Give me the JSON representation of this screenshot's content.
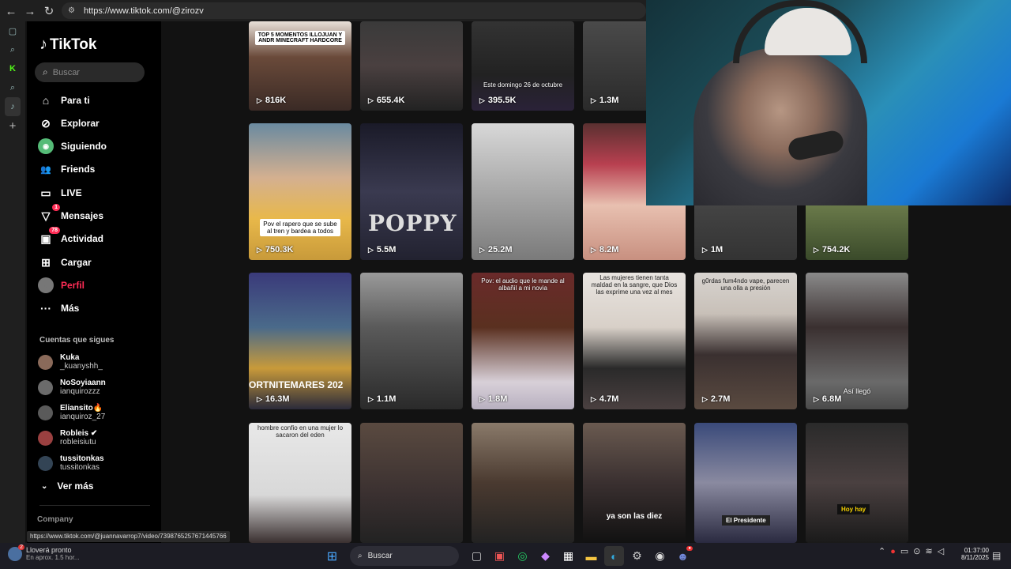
{
  "browser": {
    "url": "https://www.tiktok.com/@zirozv",
    "back_icon": "←",
    "forward_icon": "→",
    "reload_icon": "↻"
  },
  "sidebar": {
    "logo": "TikTok",
    "search_placeholder": "Buscar",
    "menu": [
      {
        "label": "Para ti",
        "icon": "⌂"
      },
      {
        "label": "Explorar",
        "icon": "⊘"
      },
      {
        "label": "Siguiendo",
        "icon": "◉"
      },
      {
        "label": "Friends",
        "icon": "👥"
      },
      {
        "label": "LIVE",
        "icon": "▭"
      },
      {
        "label": "Mensajes",
        "icon": "▽",
        "badge": "1"
      },
      {
        "label": "Actividad",
        "icon": "▣",
        "badge": "78"
      },
      {
        "label": "Cargar",
        "icon": "⊞"
      },
      {
        "label": "Perfil",
        "icon": "●"
      },
      {
        "label": "Más",
        "icon": "···"
      }
    ],
    "following_title": "Cuentas que sigues",
    "accounts": [
      {
        "name": "Kuka",
        "user": "_kuanyshh_"
      },
      {
        "name": "NoSoyiaann",
        "user": "ianquirozzz"
      },
      {
        "name": "Eliansito🔥",
        "user": "ianquiroz_27"
      },
      {
        "name": "Robleis ✔",
        "user": "robleisiutu"
      },
      {
        "name": "tussitonkas",
        "user": "tussitonkas"
      }
    ],
    "ver_mas": "Ver más",
    "company": "Company"
  },
  "videos": {
    "row1": [
      {
        "views": "816K",
        "caption": "TOP 5 MOMENTOS ILLOJUAN Y ANDR MINECRAFT HARDCORE"
      },
      {
        "views": "655.4K",
        "caption": ""
      },
      {
        "views": "395.5K",
        "caption": "Este domingo 26 de octubre"
      },
      {
        "views": "1.3M",
        "caption": ""
      }
    ],
    "row2": [
      {
        "views": "750.3K",
        "caption": "Pov el rapero que se sube al tren y bardea a todos"
      },
      {
        "views": "5.5M",
        "caption": "POPPY"
      },
      {
        "views": "25.2M",
        "caption": ""
      },
      {
        "views": "8.2M",
        "caption": ""
      },
      {
        "views": "1M",
        "caption": ""
      },
      {
        "views": "754.2K",
        "caption": ""
      }
    ],
    "row3": [
      {
        "views": "16.3M",
        "caption": "ORTNITEMARES 202"
      },
      {
        "views": "1.1M",
        "caption": ""
      },
      {
        "views": "1.8M",
        "caption": "Pov: el audio que le mande al albañil a mi novia"
      },
      {
        "views": "4.7M",
        "caption": "Las mujeres tienen tanta maldad en la sangre, que Dios las exprime una vez al mes"
      },
      {
        "views": "2.7M",
        "caption": "g0rdas fum4ndo vape, parecen una olla a presión"
      },
      {
        "views": "6.8M",
        "caption": "Así llegó"
      }
    ],
    "row4": [
      {
        "caption": "hombre confio en una mujer lo sacaron del eden"
      },
      {
        "caption": ""
      },
      {
        "caption": ""
      },
      {
        "caption": "ya son las diez"
      },
      {
        "caption": "El Presidente"
      },
      {
        "caption": "Hoy hay"
      }
    ]
  },
  "status_url": "https://www.tiktok.com/@juannavarrop7/video/7398765257671445766",
  "taskbar": {
    "weather_title": "Lloverá pronto",
    "weather_sub": "En aprox. 1.5 hor...",
    "weather_badge": "2",
    "search": "Buscar",
    "time": "01:37:00",
    "date": "8/11/2025"
  },
  "colors": {
    "accent": "#fe2c55",
    "bg": "#121212"
  }
}
